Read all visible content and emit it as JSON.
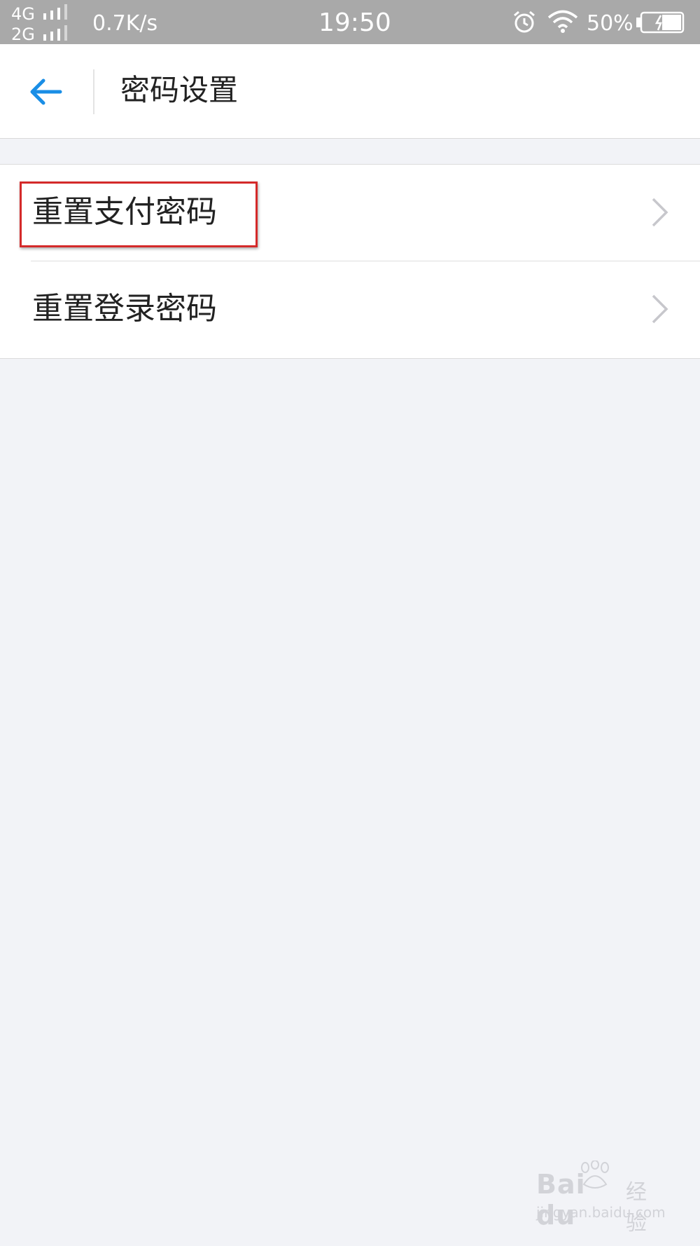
{
  "status_bar": {
    "network_1": "4G",
    "network_2": "2G",
    "speed": "0.7K/s",
    "time": "19:50",
    "battery": "50%",
    "icons": [
      "signal-bars-icon",
      "alarm-icon",
      "wifi-icon",
      "battery-charging-icon"
    ]
  },
  "app_bar": {
    "title": "密码设置",
    "back_icon": "arrow-left-icon",
    "accent_color": "#1a8ee6"
  },
  "menu": {
    "items": [
      {
        "label": "重置支付密码",
        "highlighted": true
      },
      {
        "label": "重置登录密码",
        "highlighted": false
      }
    ],
    "chevron_icon": "chevron-right-icon",
    "highlight_color": "#d42a2a"
  },
  "watermark": {
    "logo": "Bai du",
    "suffix": "经验",
    "url": "jingyan.baidu.com"
  }
}
